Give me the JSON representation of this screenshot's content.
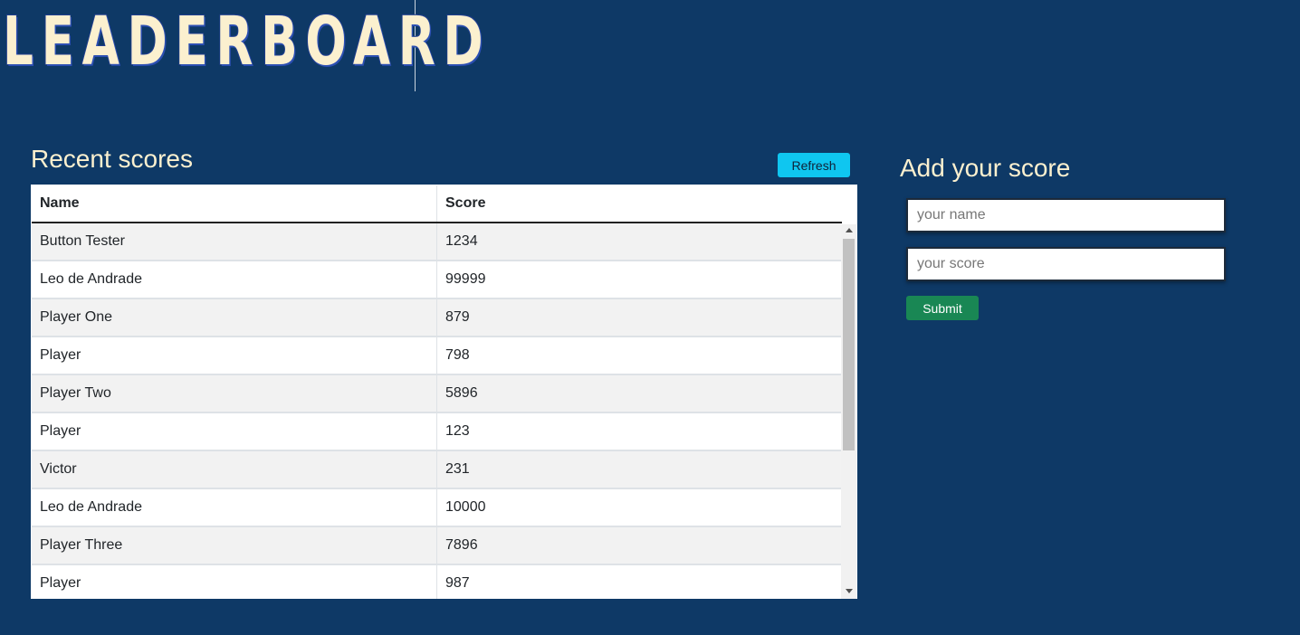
{
  "header": {
    "logo_text": "LEADERBOARD"
  },
  "recent": {
    "title": "Recent scores",
    "refresh_label": "Refresh",
    "columns": [
      "Name",
      "Score"
    ],
    "rows": [
      {
        "name": "Button Tester",
        "score": "1234"
      },
      {
        "name": "Leo de Andrade",
        "score": "99999"
      },
      {
        "name": "Player One",
        "score": "879"
      },
      {
        "name": "Player",
        "score": "798"
      },
      {
        "name": "Player Two",
        "score": "5896"
      },
      {
        "name": "Player",
        "score": "123"
      },
      {
        "name": "Victor",
        "score": "231"
      },
      {
        "name": "Leo de Andrade",
        "score": "10000"
      },
      {
        "name": "Player Three",
        "score": "7896"
      },
      {
        "name": "Player",
        "score": "987"
      }
    ]
  },
  "add": {
    "title": "Add your score",
    "name_placeholder": "your name",
    "score_placeholder": "your score",
    "submit_label": "Submit"
  },
  "colors": {
    "background": "#0e3966",
    "heading": "#fbf0cf",
    "refresh_button": "#0fc6f0",
    "submit_button": "#198754"
  }
}
